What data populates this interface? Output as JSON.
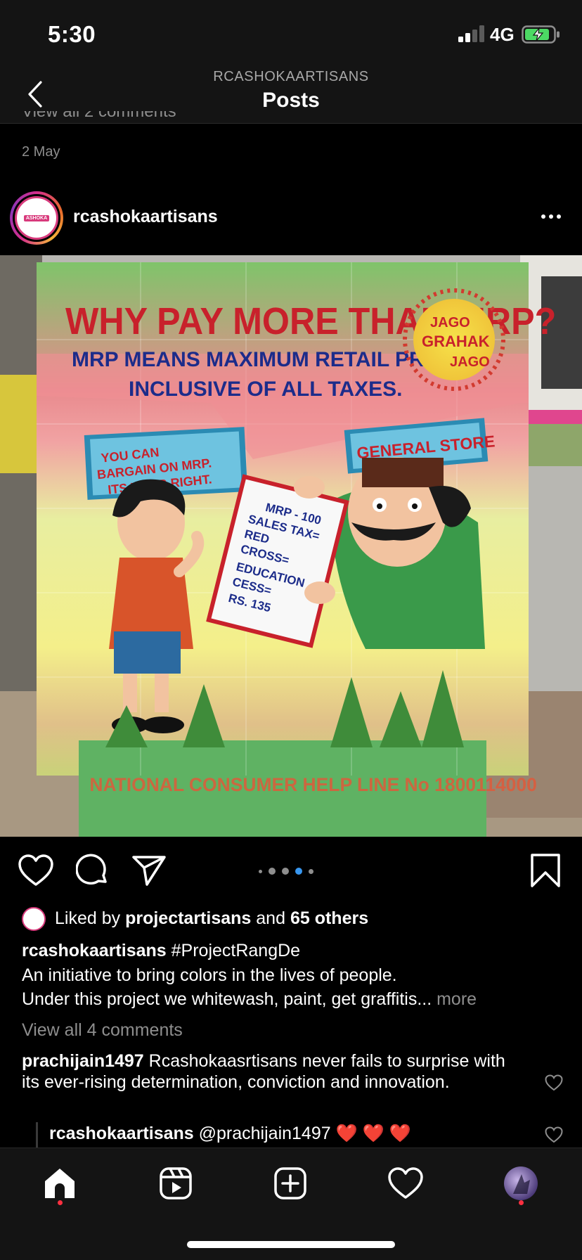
{
  "status_bar": {
    "time": "5:30",
    "network": "4G",
    "battery_charging": true
  },
  "header": {
    "account": "RCASHOKAARTISANS",
    "title": "Posts",
    "back_icon": "chevron-left-icon"
  },
  "previous_post": {
    "comments_link": "View all 2 comments",
    "date": "2 May"
  },
  "post": {
    "username": "rcashokaartisans",
    "avatar_logo_text": "ASHOKA",
    "image": {
      "headline": "WHY PAY MORE THAN MRP?",
      "sub1": "MRP MEANS MAXIMUM RETAIL PRICE",
      "sub2": "INCLUSIVE OF ALL TAXES.",
      "badge1": "JAGO",
      "badge2": "GRAHAK",
      "badge3": "JAGO",
      "bargain1": "YOU CAN",
      "bargain2": "BARGAIN ON MRP.",
      "bargain3": "ITS YOUR RIGHT.",
      "store": "GENERAL STORE",
      "bill1": "MRP - 100",
      "bill2": "SALES TAX=",
      "bill3": "RED",
      "bill4": "CROSS=",
      "bill5": "EDUCATION",
      "bill6": "CESS=",
      "bill7": "RS. 135",
      "helpline": "NATIONAL CONSUMER HELP LINE No 1800114000"
    },
    "carousel": {
      "total": 5,
      "active_index": 3
    },
    "likes": {
      "prefix": "Liked by",
      "first_user": "projectartisans",
      "middle": "and",
      "others": "65 others"
    },
    "caption": {
      "username": "rcashokaartisans",
      "hashtag": "#ProjectRangDe",
      "line1": "An initiative to bring colors in the lives of people.",
      "line2": "Under this project we whitewash, paint, get graffitis...",
      "more": "more"
    },
    "view_comments": "View all 4 comments",
    "comments": [
      {
        "username": "prachijain1497",
        "text": "Rcashokaasrtisans never fails to surprise with its ever-rising determination, conviction and innovation."
      }
    ],
    "reply": {
      "username": "rcashokaartisans",
      "mention": "@prachijain1497",
      "emoji": "❤️ ❤️ ❤️"
    }
  },
  "tab_bar": {
    "tabs": [
      "home-icon",
      "reels-icon",
      "create-icon",
      "activity-icon",
      "profile-avatar"
    ],
    "active": "home-icon"
  },
  "colors": {
    "background": "#000000",
    "muted_text": "#8e8e8e",
    "active_dot": "#3897f0",
    "notification_dot": "#ff3040",
    "battery_green": "#4cd964"
  }
}
